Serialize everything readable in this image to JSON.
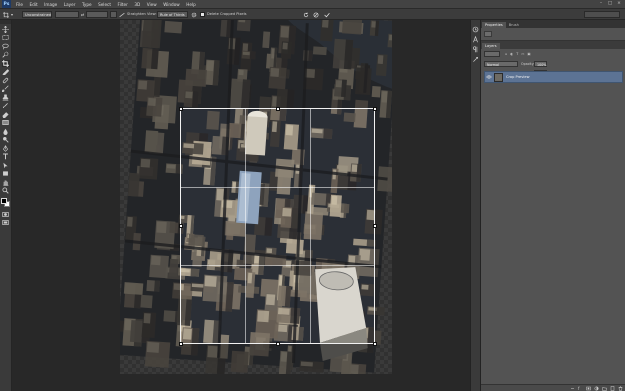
{
  "app": {
    "logo_text": "Ps"
  },
  "menu": [
    "File",
    "Edit",
    "Image",
    "Layer",
    "Type",
    "Select",
    "Filter",
    "3D",
    "View",
    "Window",
    "Help"
  ],
  "window_controls": [
    "–",
    "□",
    "×"
  ],
  "options_bar": {
    "ratio_value": "Unconstrained",
    "straighten_label": "Straighten",
    "view_label": "View:",
    "view_value": "Rule of Thirds",
    "delete_cropped_label": "Delete Cropped Pixels"
  },
  "tools": [
    "move-tool",
    "marquee-tool",
    "lasso-tool",
    "quick-select-tool",
    "crop-tool",
    "eyedropper-tool",
    "healing-tool",
    "brush-tool",
    "clone-stamp-tool",
    "history-brush-tool",
    "eraser-tool",
    "gradient-tool",
    "blur-tool",
    "dodge-tool",
    "pen-tool",
    "type-tool",
    "path-select-tool",
    "shape-tool",
    "hand-tool",
    "zoom-tool"
  ],
  "panels": {
    "properties_tab": "Properties",
    "brush_tab": "Brush",
    "layers_tab": "Layers",
    "blend_mode": "Normal",
    "opacity_label": "Opacity:",
    "opacity_value": "100%",
    "lock_label": "Lock:",
    "fill_label": "Fill:",
    "fill_value": "100%",
    "layer_name": "Crop Preview"
  },
  "colors": {
    "foreground": "#000000",
    "background": "#ffffff",
    "accent": "#5c7394"
  }
}
